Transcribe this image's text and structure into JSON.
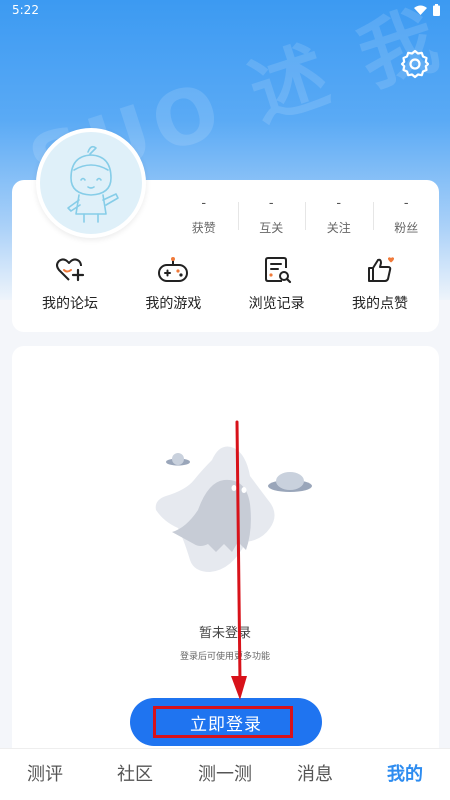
{
  "status": {
    "time": "5:22"
  },
  "header": {
    "watermark": "SUO 述 我"
  },
  "profile": {
    "stats": [
      {
        "value": "-",
        "label": "获赞"
      },
      {
        "value": "-",
        "label": "互关"
      },
      {
        "value": "-",
        "label": "关注"
      },
      {
        "value": "-",
        "label": "粉丝"
      }
    ],
    "shortcuts": [
      {
        "label": "我的论坛",
        "icon": "heart-plus-icon"
      },
      {
        "label": "我的游戏",
        "icon": "gamepad-icon"
      },
      {
        "label": "浏览记录",
        "icon": "history-doc-icon"
      },
      {
        "label": "我的点赞",
        "icon": "thumbs-up-icon"
      }
    ]
  },
  "empty_state": {
    "title": "暂未登录",
    "subtitle": "登录后可使用更多功能"
  },
  "login": {
    "label": "立即登录"
  },
  "tabbar": {
    "tabs": [
      {
        "label": "测评"
      },
      {
        "label": "社区"
      },
      {
        "label": "测一测"
      },
      {
        "label": "消息"
      },
      {
        "label": "我的",
        "active": true
      }
    ]
  },
  "colors": {
    "accent": "#1f74f0",
    "tab_active": "#2d8cf0",
    "annotation": "#d8121a"
  }
}
